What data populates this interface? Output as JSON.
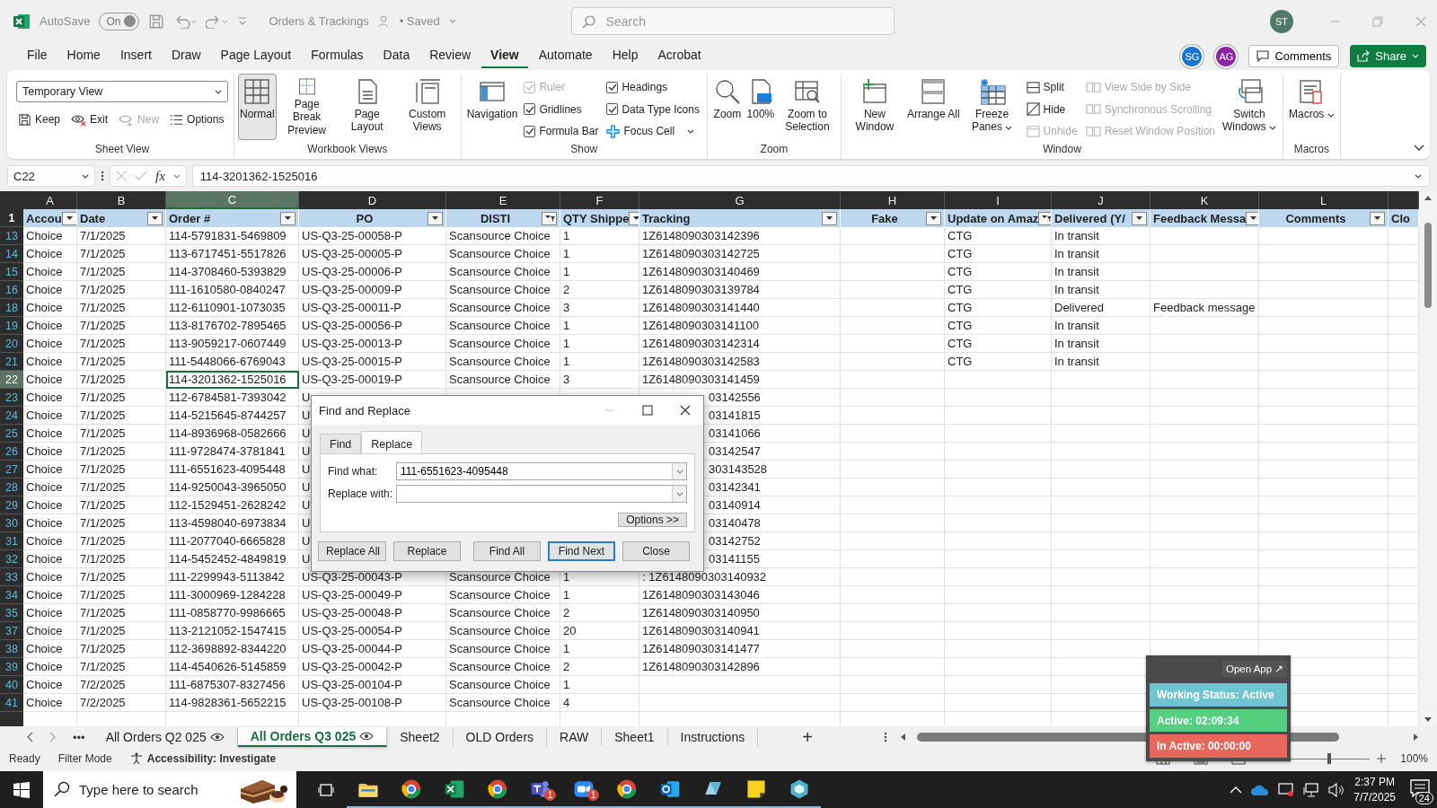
{
  "title_bar": {
    "autosave_label": "AutoSave",
    "autosave_toggle": "On",
    "autosave_on": true,
    "document_title": "Orders & Trackings",
    "save_status": "• Saved",
    "search_placeholder": "Search",
    "user_initials": "ST"
  },
  "menu_tabs": [
    {
      "label": "File",
      "selected": false
    },
    {
      "label": "Home",
      "selected": false
    },
    {
      "label": "Insert",
      "selected": false
    },
    {
      "label": "Draw",
      "selected": false
    },
    {
      "label": "Page Layout",
      "selected": false
    },
    {
      "label": "Formulas",
      "selected": false
    },
    {
      "label": "Data",
      "selected": false
    },
    {
      "label": "Review",
      "selected": false
    },
    {
      "label": "View",
      "selected": true
    },
    {
      "label": "Automate",
      "selected": false
    },
    {
      "label": "Help",
      "selected": false
    },
    {
      "label": "Acrobat",
      "selected": false
    }
  ],
  "collaborators": [
    {
      "initials": "SG",
      "color": "#1976d2"
    },
    {
      "initials": "AG",
      "color": "#8e24aa"
    }
  ],
  "comments_button": "Comments",
  "share_button": "Share",
  "ribbon": [
    {
      "label": "Sheet View",
      "columns": [
        {
          "kind": "sheet_view",
          "combo": "Temporary View",
          "buttons": [
            {
              "label": "Keep",
              "disabled": false
            },
            {
              "label": "Exit",
              "disabled": false
            },
            {
              "label": "New",
              "disabled": true
            },
            {
              "label": "Options",
              "disabled": false
            }
          ]
        }
      ]
    },
    {
      "label": "Workbook Views",
      "columns": [
        {
          "kind": "large",
          "label": "Normal",
          "selected": true,
          "caret": false
        },
        {
          "kind": "large",
          "label": "Page Break Preview",
          "selected": false,
          "caret": false
        },
        {
          "kind": "large",
          "label": "Page Layout",
          "selected": false,
          "caret": false
        },
        {
          "kind": "large",
          "label": "Custom Views",
          "selected": false,
          "caret": false
        }
      ]
    },
    {
      "label": "Show",
      "columns": [
        {
          "kind": "large",
          "label": "Navigation",
          "selected": false,
          "caret": false
        },
        {
          "kind": "stack",
          "items": [
            {
              "kind": "check",
              "label": "Ruler",
              "checked": true,
              "disabled": true
            },
            {
              "kind": "check",
              "label": "Gridlines",
              "checked": true,
              "disabled": false
            },
            {
              "kind": "check",
              "label": "Formula Bar",
              "checked": true,
              "disabled": false
            }
          ]
        },
        {
          "kind": "stack",
          "items": [
            {
              "kind": "check",
              "label": "Headings",
              "checked": true,
              "disabled": false
            },
            {
              "kind": "check",
              "label": "Data Type Icons",
              "checked": true,
              "disabled": false
            },
            {
              "kind": "button",
              "label": "Focus Cell",
              "disabled": false,
              "caret": true
            }
          ]
        }
      ]
    },
    {
      "label": "Zoom",
      "columns": [
        {
          "kind": "large",
          "label": "Zoom",
          "selected": false,
          "caret": false
        },
        {
          "kind": "large",
          "label": "100%",
          "selected": false,
          "caret": false
        },
        {
          "kind": "large",
          "label": "Zoom to Selection",
          "selected": false,
          "caret": false
        }
      ]
    },
    {
      "label": "Window",
      "columns": [
        {
          "kind": "large",
          "label": "New Window",
          "selected": false,
          "caret": false
        },
        {
          "kind": "large",
          "label": "Arrange All",
          "selected": false,
          "caret": false
        },
        {
          "kind": "large",
          "label": "Freeze Panes",
          "selected": false,
          "caret": true
        },
        {
          "kind": "stack",
          "items": [
            {
              "kind": "button",
              "label": "Split",
              "disabled": false,
              "caret": false
            },
            {
              "kind": "button",
              "label": "Hide",
              "disabled": false,
              "caret": false
            },
            {
              "kind": "button",
              "label": "Unhide",
              "disabled": true,
              "caret": false
            }
          ]
        },
        {
          "kind": "stack",
          "items": [
            {
              "kind": "button",
              "label": "View Side by Side",
              "disabled": true,
              "caret": false
            },
            {
              "kind": "button",
              "label": "Synchronous Scrolling",
              "disabled": true,
              "caret": false
            },
            {
              "kind": "button",
              "label": "Reset Window Position",
              "disabled": true,
              "caret": false
            }
          ]
        },
        {
          "kind": "large",
          "label": "Switch Windows",
          "selected": false,
          "caret": true
        }
      ]
    },
    {
      "label": "Macros",
      "columns": [
        {
          "kind": "large",
          "label": "Macros",
          "selected": false,
          "caret": true
        }
      ]
    }
  ],
  "formula_bar": {
    "name_box": "C22",
    "function_label": "fx",
    "formula": "114-3201362-1525016"
  },
  "columns": [
    {
      "letter": "A",
      "header": "Accou",
      "selected": false,
      "filtered": false
    },
    {
      "letter": "B",
      "header": "Date",
      "selected": false,
      "filtered": false,
      "centered": false
    },
    {
      "letter": "C",
      "header": "Order #",
      "selected": true,
      "filtered": false,
      "centered": false
    },
    {
      "letter": "D",
      "header": "PO",
      "selected": false,
      "filtered": false,
      "centered": true
    },
    {
      "letter": "E",
      "header": "DISTI",
      "selected": false,
      "filtered": true,
      "centered": true
    },
    {
      "letter": "F",
      "header": "QTY Shippe",
      "selected": false,
      "filtered": false
    },
    {
      "letter": "G",
      "header": "Tracking",
      "selected": false,
      "filtered": false,
      "centered": false
    },
    {
      "letter": "H",
      "header": "Fake",
      "selected": false,
      "filtered": false,
      "centered": true
    },
    {
      "letter": "I",
      "header": "Update on Amaz",
      "selected": false,
      "filtered": true,
      "centered": false
    },
    {
      "letter": "J",
      "header": "Delivered (Y/",
      "selected": false,
      "filtered": false,
      "centered": false
    },
    {
      "letter": "K",
      "header": "Feedback Messa",
      "selected": false,
      "filtered": false
    },
    {
      "letter": "L",
      "header": "Comments",
      "selected": false,
      "filtered": false,
      "centered": true
    },
    {
      "header": "Clo"
    }
  ],
  "header_row_number": "1",
  "rows": [
    {
      "num": "13",
      "selected": false,
      "kind": "plain",
      "cells": {
        "A": "Choice",
        "B": "7/1/2025",
        "C": "114-5791831-5469809",
        "D": "US-Q3-25-00058-P",
        "E": "Scansource Choice",
        "F": "1",
        "G": "1Z6148090303142396",
        "I": "CTG",
        "J": "In transit"
      }
    },
    {
      "num": "14",
      "selected": false,
      "kind": "plain",
      "cells": {
        "A": "Choice",
        "B": "7/1/2025",
        "C": "113-6717451-5517826",
        "D": "US-Q3-25-00005-P",
        "E": "Scansource Choice",
        "F": "1",
        "G": "1Z6148090303142725",
        "I": "CTG",
        "J": "In transit"
      }
    },
    {
      "num": "15",
      "selected": false,
      "kind": "plain",
      "cells": {
        "A": "Choice",
        "B": "7/1/2025",
        "C": "114-3708460-5393829",
        "D": "US-Q3-25-00006-P",
        "E": "Scansource Choice",
        "F": "1",
        "G": "1Z6148090303140469",
        "I": "CTG",
        "J": "In transit"
      }
    },
    {
      "num": "16",
      "selected": false,
      "kind": "plain",
      "cells": {
        "A": "Choice",
        "B": "7/1/2025",
        "C": "111-1610580-0840247",
        "D": "US-Q3-25-00009-P",
        "E": "Scansource Choice",
        "F": "2",
        "G": "1Z6148090303139784",
        "I": "CTG",
        "J": "In transit"
      }
    },
    {
      "num": "18",
      "selected": false,
      "kind": "plain",
      "cells": {
        "A": "Choice",
        "B": "7/1/2025",
        "C": "112-6110901-1073035",
        "D": "US-Q3-25-00011-P",
        "E": "Scansource Choice",
        "F": "3",
        "G": "1Z6148090303141440",
        "I": "CTG",
        "J": "Delivered",
        "K": "Feedback message"
      }
    },
    {
      "num": "19",
      "selected": false,
      "kind": "plain",
      "cells": {
        "A": "Choice",
        "B": "7/1/2025",
        "C": "113-8176702-7895465",
        "D": "US-Q3-25-00056-P",
        "E": "Scansource Choice",
        "F": "1",
        "G": "1Z6148090303141100",
        "I": "CTG",
        "J": "In transit"
      }
    },
    {
      "num": "20",
      "selected": false,
      "kind": "plain",
      "cells": {
        "A": "Choice",
        "B": "7/1/2025",
        "C": "113-9059217-0607449",
        "D": "US-Q3-25-00013-P",
        "E": "Scansource Choice",
        "F": "1",
        "G": "1Z6148090303142314",
        "I": "CTG",
        "J": "In transit"
      }
    },
    {
      "num": "21",
      "selected": false,
      "kind": "plain",
      "cells": {
        "A": "Choice",
        "B": "7/1/2025",
        "C": "111-5448066-6769043",
        "D": "US-Q3-25-00015-P",
        "E": "Scansource Choice",
        "F": "1",
        "G": "1Z6148090303142583",
        "I": "CTG",
        "J": "In transit"
      }
    },
    {
      "num": "22",
      "selected": true,
      "kind": "plain",
      "cells": {
        "A": "Choice",
        "B": "7/1/2025",
        "C": "114-3201362-1525016",
        "D": "US-Q3-25-00019-P",
        "E": "Scansource Choice",
        "F": "3",
        "G": "1Z6148090303141459"
      }
    },
    {
      "num": "23",
      "selected": false,
      "kind": "covered",
      "cells": {
        "A": "Choice",
        "B": "7/1/2025",
        "C": "112-6784581-7393042",
        "D": "U",
        "G": "03142556"
      }
    },
    {
      "num": "24",
      "selected": false,
      "kind": "covered",
      "cells": {
        "A": "Choice",
        "B": "7/1/2025",
        "C": "114-5215645-8744257",
        "D": "U",
        "G": "03141815"
      }
    },
    {
      "num": "25",
      "selected": false,
      "kind": "covered",
      "cells": {
        "A": "Choice",
        "B": "7/1/2025",
        "C": "114-8936968-0582666",
        "D": "U",
        "G": "03141066"
      }
    },
    {
      "num": "26",
      "selected": false,
      "kind": "covered",
      "cells": {
        "A": "Choice",
        "B": "7/1/2025",
        "C": "111-9728474-3781841",
        "D": "U",
        "G": "03142547"
      }
    },
    {
      "num": "27",
      "selected": false,
      "kind": "covered",
      "cells": {
        "A": "Choice",
        "B": "7/1/2025",
        "C": "111-6551623-4095448",
        "D": "U",
        "G": "303143528"
      }
    },
    {
      "num": "28",
      "selected": false,
      "kind": "covered",
      "cells": {
        "A": "Choice",
        "B": "7/1/2025",
        "C": "114-9250043-3965050",
        "D": "U",
        "G": "03142341"
      }
    },
    {
      "num": "29",
      "selected": false,
      "kind": "covered",
      "cells": {
        "A": "Choice",
        "B": "7/1/2025",
        "C": "112-1529451-2628242",
        "D": "U",
        "G": "03140914"
      }
    },
    {
      "num": "30",
      "selected": false,
      "kind": "covered",
      "cells": {
        "A": "Choice",
        "B": "7/1/2025",
        "C": "113-4598040-6973834",
        "D": "U",
        "G": "03140478"
      }
    },
    {
      "num": "31",
      "selected": false,
      "kind": "covered",
      "cells": {
        "A": "Choice",
        "B": "7/1/2025",
        "C": "111-2077040-6665828",
        "D": "U",
        "G": "03142752"
      }
    },
    {
      "num": "32",
      "selected": false,
      "kind": "covered",
      "cells": {
        "A": "Choice",
        "B": "7/1/2025",
        "C": "114-5452452-4849819",
        "D": "U",
        "G": "03141155"
      }
    },
    {
      "num": "33",
      "selected": false,
      "kind": "plain",
      "cells": {
        "A": "Choice",
        "B": "7/1/2025",
        "C": "111-2299943-5113842",
        "D": "US-Q3-25-00043-P",
        "E": "Scansource Choice",
        "F": "1",
        "G": ": 1Z6148090303140932"
      }
    },
    {
      "num": "34",
      "selected": false,
      "kind": "plain",
      "cells": {
        "A": "Choice",
        "B": "7/1/2025",
        "C": "111-3000969-1284228",
        "D": "US-Q3-25-00049-P",
        "E": "Scansource Choice",
        "F": "1",
        "G": "1Z6148090303143046"
      }
    },
    {
      "num": "35",
      "selected": false,
      "kind": "plain",
      "cells": {
        "A": "Choice",
        "B": "7/1/2025",
        "C": "111-0858770-9986665",
        "D": "US-Q3-25-00048-P",
        "E": "Scansource Choice",
        "F": "2",
        "G": "1Z6148090303140950"
      }
    },
    {
      "num": "37",
      "selected": false,
      "kind": "plain",
      "cells": {
        "A": "Choice",
        "B": "7/1/2025",
        "C": "113-2121052-1547415",
        "D": "US-Q3-25-00054-P",
        "E": "Scansource Choice",
        "F": "20",
        "G": "1Z6148090303140941"
      }
    },
    {
      "num": "38",
      "selected": false,
      "kind": "plain",
      "cells": {
        "A": "Choice",
        "B": "7/1/2025",
        "C": "112-3698892-8344220",
        "D": "US-Q3-25-00044-P",
        "E": "Scansource Choice",
        "F": "1",
        "G": "1Z6148090303141477"
      }
    },
    {
      "num": "39",
      "selected": false,
      "kind": "plain",
      "cells": {
        "A": "Choice",
        "B": "7/1/2025",
        "C": "114-4540626-5145859",
        "D": "US-Q3-25-00042-P",
        "E": "Scansource Choice",
        "F": "2",
        "G": "1Z6148090303142896"
      }
    },
    {
      "num": "40",
      "selected": false,
      "kind": "plain",
      "cells": {
        "A": "Choice",
        "B": "7/2/2025",
        "C": "111-6875307-8327456",
        "D": "US-Q3-25-00104-P",
        "E": "Scansource Choice",
        "F": "1"
      }
    },
    {
      "num": "41",
      "selected": false,
      "kind": "plain",
      "cells": {
        "A": "Choice",
        "B": "7/2/2025",
        "C": "114-9828361-5652215",
        "D": "US-Q3-25-00108-P",
        "E": "Scansource Choice",
        "F": "4"
      }
    }
  ],
  "dialog": {
    "title": "Find and Replace",
    "tabs": [
      {
        "label": "Find",
        "selected": false
      },
      {
        "label": "Replace",
        "selected": true
      }
    ],
    "fields": [
      {
        "label": "Find what:",
        "value": "111-6551623-4095448"
      },
      {
        "label": "Replace with:"
      }
    ],
    "options_button": "Options >>",
    "buttons": [
      {
        "label": "Replace All",
        "default": false
      },
      {
        "label": "Replace",
        "default": false
      },
      {
        "label": "Find All",
        "default": false
      },
      {
        "label": "Find Next",
        "default": true
      },
      {
        "label": "Close",
        "default": false
      }
    ]
  },
  "sheet_tabs": {
    "more": "•••",
    "tabs": [
      {
        "label": "All Orders Q2 025",
        "selected": false,
        "eye": true
      },
      {
        "label": "All Orders Q3 025",
        "selected": true,
        "eye": true
      },
      {
        "label": "Sheet2",
        "selected": false,
        "eye": false
      },
      {
        "label": "OLD Orders",
        "selected": false,
        "eye": false
      },
      {
        "label": "RAW",
        "selected": false,
        "eye": false
      },
      {
        "label": "Sheet1",
        "selected": false,
        "eye": false
      },
      {
        "label": "Instructions",
        "selected": false,
        "eye": false
      }
    ],
    "add": "+"
  },
  "status_bar": {
    "ready": "Ready",
    "mode": "Filter Mode",
    "accessibility": "Accessibility: Investigate",
    "level": 0.5,
    "zoom": "100%"
  },
  "tracker": {
    "open_app": "Open App ↗",
    "statuses": [
      {
        "label": "Working Status: Active",
        "color": "#70c3d0"
      },
      {
        "label": "Active: 02:09:34",
        "color": "#52cf7f"
      },
      {
        "label": "In Active: 00:00:00",
        "color": "#e8675c"
      }
    ]
  },
  "taskbar": {
    "search_placeholder": "Type here to search",
    "apps": [
      {
        "running": true
      },
      {
        "running": true
      },
      {
        "running": true
      },
      {
        "running": true
      },
      {
        "running": true,
        "badge": "1"
      },
      {
        "running": true,
        "badge": "1"
      },
      {
        "running": true
      },
      {
        "running": true
      },
      {
        "running": true
      },
      {
        "running": true
      },
      {
        "running": true
      }
    ],
    "time": "2:37 PM",
    "date": "7/7/2025",
    "notifications": "24"
  }
}
